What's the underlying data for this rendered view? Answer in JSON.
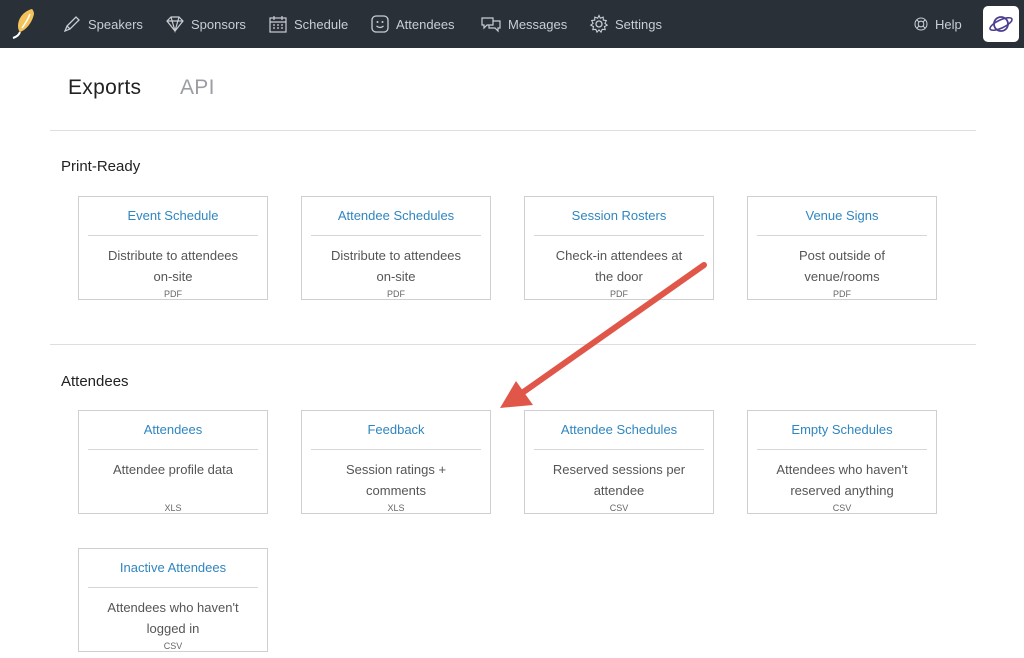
{
  "nav": {
    "items": [
      {
        "label": "Speakers",
        "icon": "pen-icon"
      },
      {
        "label": "Sponsors",
        "icon": "diamond-icon"
      },
      {
        "label": "Schedule",
        "icon": "calendar-icon"
      },
      {
        "label": "Attendees",
        "icon": "smiley-face-icon"
      },
      {
        "label": "Messages",
        "icon": "chat-bubbles-icon"
      },
      {
        "label": "Settings",
        "icon": "gear-icon"
      }
    ],
    "help": {
      "label": "Help",
      "icon": "lifebuoy-icon"
    },
    "avatar_icon": "planet-icon",
    "logo_icon": "feather-logo-icon"
  },
  "tabs": {
    "exports": "Exports",
    "api": "API"
  },
  "sections": {
    "print_ready": {
      "title": "Print-Ready",
      "cards": [
        {
          "title": "Event Schedule",
          "desc1": "Distribute to attendees",
          "desc2": "on-site",
          "format": "PDF"
        },
        {
          "title": "Attendee Schedules",
          "desc1": "Distribute to attendees",
          "desc2": "on-site",
          "format": "PDF"
        },
        {
          "title": "Session Rosters",
          "desc1": "Check-in attendees at",
          "desc2": "the door",
          "format": "PDF"
        },
        {
          "title": "Venue Signs",
          "desc1": "Post outside of",
          "desc2": "venue/rooms",
          "format": "PDF"
        }
      ]
    },
    "attendees": {
      "title": "Attendees",
      "cards": [
        {
          "title": "Attendees",
          "desc1": "Attendee profile data",
          "desc2": "",
          "format": "XLS"
        },
        {
          "title": "Feedback",
          "desc1": "Session ratings +",
          "desc2": "comments",
          "format": "XLS"
        },
        {
          "title": "Attendee Schedules",
          "desc1": "Reserved sessions per",
          "desc2": "attendee",
          "format": "CSV"
        },
        {
          "title": "Empty Schedules",
          "desc1": "Attendees who haven't",
          "desc2": "reserved anything",
          "format": "CSV"
        },
        {
          "title": "Inactive Attendees",
          "desc1": "Attendees who haven't",
          "desc2": "logged in",
          "format": "CSV"
        }
      ]
    }
  },
  "colors": {
    "nav_bg": "#2a3038",
    "nav_text": "#c9ced4",
    "link": "#2f86c0",
    "annotation_arrow": "#e0574a"
  }
}
